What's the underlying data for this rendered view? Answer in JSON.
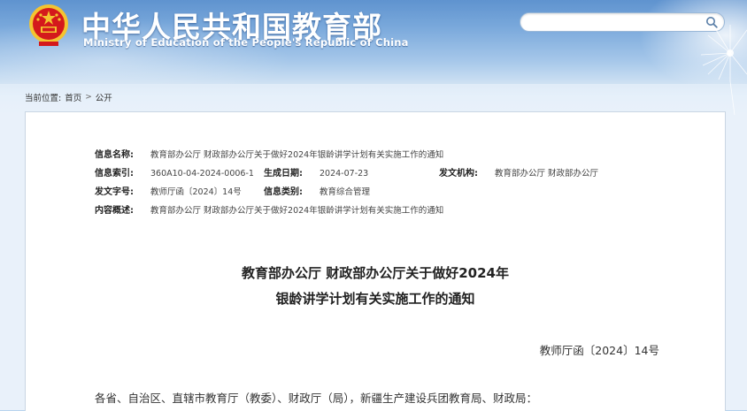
{
  "header": {
    "title_cn": "中华人民共和国教育部",
    "title_en": "Ministry of Education of the People's Republic of China",
    "search": {
      "placeholder": "",
      "icon": "search-icon"
    }
  },
  "breadcrumb": {
    "prefix": "当前位置:",
    "items": [
      "首页",
      "公开"
    ],
    "separator": ">"
  },
  "meta": {
    "name_label": "信息名称:",
    "name_value": "教育部办公厅 财政部办公厅关于做好2024年银龄讲学计划有关实施工作的通知",
    "index_label": "信息索引:",
    "index_value": "360A10-04-2024-0006-1",
    "date_label": "生成日期:",
    "date_value": "2024-07-23",
    "issuer_label": "发文机构:",
    "issuer_value": "教育部办公厅 财政部办公厅",
    "docno_label": "发文字号:",
    "docno_value": "教师厅函〔2024〕14号",
    "category_label": "信息类别:",
    "category_value": "教育综合管理",
    "summary_label": "内容概述:",
    "summary_value": "教育部办公厅 财政部办公厅关于做好2024年银龄讲学计划有关实施工作的通知"
  },
  "document": {
    "title_line1": "教育部办公厅 财政部办公厅关于做好2024年",
    "title_line2": "银龄讲学计划有关实施工作的通知",
    "number": "教师厅函〔2024〕14号",
    "salutation": "各省、自治区、直辖市教育厅（教委）、财政厅（局），新疆生产建设兵团教育局、财政局："
  },
  "colors": {
    "header_blue": "#5f93cf",
    "emblem_red": "#d4191c",
    "emblem_gold": "#f4c430"
  }
}
